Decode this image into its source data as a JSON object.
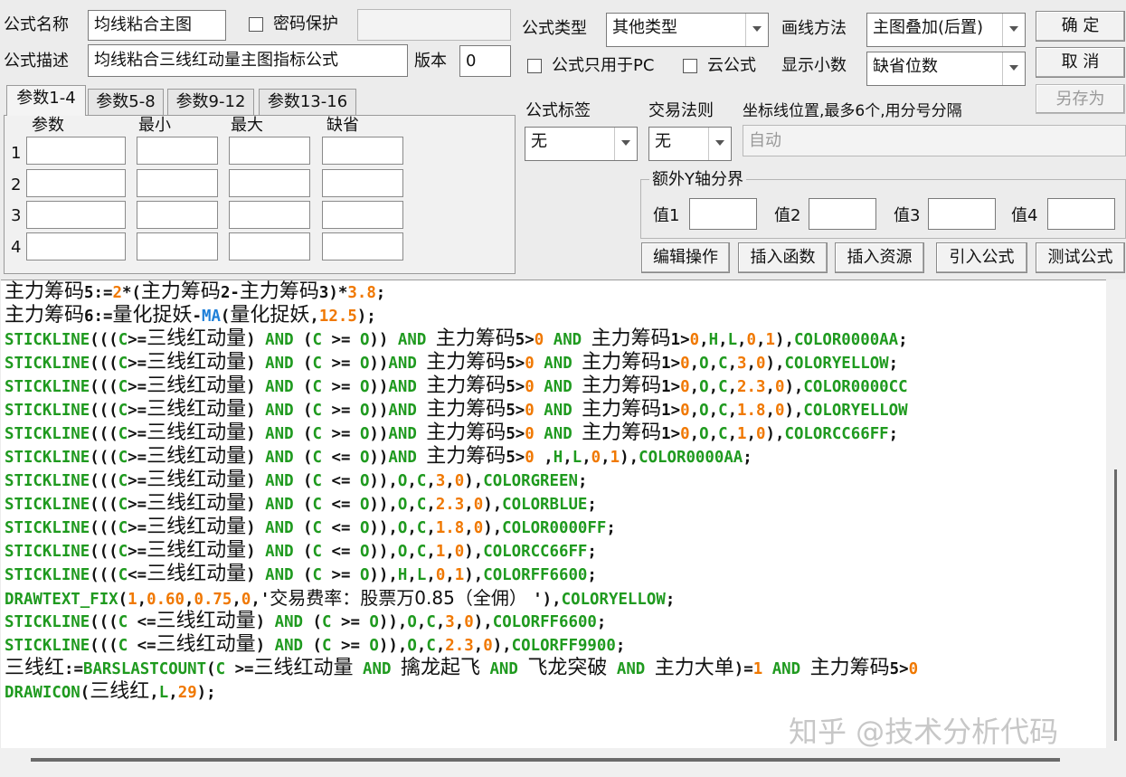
{
  "form": {
    "name_label": "公式名称",
    "name_value": "均线粘合主图",
    "password_label": "密码保护",
    "type_label": "公式类型",
    "type_value": "其他类型",
    "draw_method_label": "画线方法",
    "draw_method_value": "主图叠加(后置)",
    "desc_label": "公式描述",
    "desc_value": "均线粘合三线红动量主图指标公式",
    "version_label": "版本",
    "version_value": "0",
    "pc_only_label": "公式只用于PC",
    "cloud_label": "云公式",
    "decimals_label": "显示小数",
    "decimals_value": "缺省位数",
    "tag_label": "公式标签",
    "tag_value": "无",
    "rule_label": "交易法则",
    "rule_value": "无",
    "axis_label": "坐标线位置,最多6个,用分号分隔",
    "axis_value": "自动",
    "yaxis_group_label": "额外Y轴分界",
    "yaxis_values": [
      "值1",
      "值2",
      "值3",
      "值4"
    ]
  },
  "buttons": {
    "ok": "确  定",
    "cancel": "取  消",
    "save_as": "另存为",
    "edit_ops": "编辑操作",
    "insert_func": "插入函数",
    "insert_res": "插入资源",
    "import_formula": "引入公式",
    "test_formula": "测试公式"
  },
  "tabs": [
    "参数1-4",
    "参数5-8",
    "参数9-12",
    "参数13-16"
  ],
  "param_headers": [
    "参数",
    "最小",
    "最大",
    "缺省"
  ],
  "param_rows": [
    "1",
    "2",
    "3",
    "4"
  ],
  "code_lines": [
    "主力筹码5:=2*(主力筹码2-主力筹码3)*3.8;",
    "主力筹码6:=量化捉妖-MA(量化捉妖,12.5);",
    "STICKLINE(((C>=三线红动量) AND (C >= O)) AND 主力筹码5>0 AND 主力筹码1>0,H,L,0,1),COLOR0000AA;",
    "STICKLINE(((C>=三线红动量) AND (C >= O))AND 主力筹码5>0 AND 主力筹码1>0,O,C,3,0),COLORYELLOW;",
    "STICKLINE(((C>=三线红动量) AND (C >= O))AND 主力筹码5>0 AND 主力筹码1>0,O,C,2.3,0),COLOR0000CC",
    "STICKLINE(((C>=三线红动量) AND (C >= O))AND 主力筹码5>0 AND 主力筹码1>0,O,C,1.8,0),COLORYELLOW",
    "STICKLINE(((C>=三线红动量) AND (C >= O))AND 主力筹码5>0 AND 主力筹码1>0,O,C,1,0),COLORCC66FF;",
    "STICKLINE(((C>=三线红动量) AND (C <= O))AND 主力筹码5>0 ,H,L,0,1),COLOR0000AA;",
    "STICKLINE(((C>=三线红动量) AND (C <= O)),O,C,3,0),COLORGREEN;",
    "STICKLINE(((C>=三线红动量) AND (C <= O)),O,C,2.3,0),COLORBLUE;",
    "STICKLINE(((C>=三线红动量) AND (C <= O)),O,C,1.8,0),COLOR0000FF;",
    "STICKLINE(((C>=三线红动量) AND (C <= O)),O,C,1,0),COLORCC66FF;",
    "STICKLINE(((C<=三线红动量) AND (C >= O)),H,L,0,1),COLORFF6600;",
    "DRAWTEXT_FIX(1,0.60,0.75,0,'交易费率：股票万0.85（全佣） '),COLORYELLOW;",
    "STICKLINE(((C <=三线红动量) AND (C >= O)),O,C,3,0),COLORFF6600;",
    "STICKLINE(((C <=三线红动量) AND (C >= O)),O,C,2.3,0),COLORFF9900;",
    "三线红:=BARSLASTCOUNT(C >=三线红动量 AND 擒龙起飞 AND 飞龙突破 AND 主力大单)=1 AND 主力筹码5>0",
    "DRAWICON(三线红,L,29);"
  ],
  "watermark": "知乎 @技术分析代码",
  "colors": {
    "keyword": "#1f9a1f",
    "number": "#f07800",
    "function_ma": "#1e7fd8",
    "text": "#111111"
  }
}
